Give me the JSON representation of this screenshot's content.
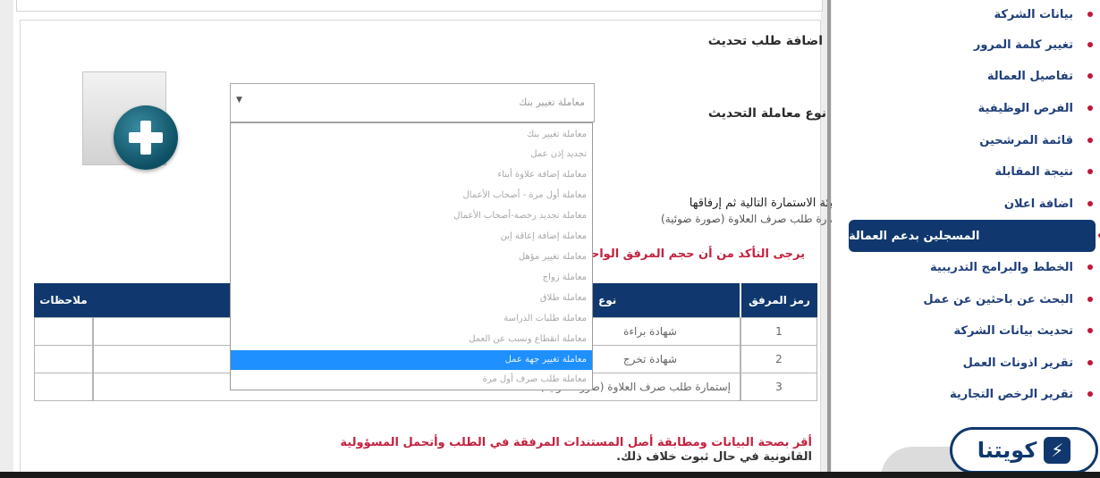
{
  "sidebar": {
    "items": [
      {
        "label": "بيانات الشركة"
      },
      {
        "label": "تغيير كلمة المرور"
      },
      {
        "label": "تفاصيل العمالة"
      },
      {
        "label": "الفرص الوظيفية"
      },
      {
        "label": "قائمة المرشحين"
      },
      {
        "label": "نتيجة المقابلة"
      },
      {
        "label": "اضافة اعلان"
      },
      {
        "label": "المسجلين بدعم العمالة",
        "active": true
      },
      {
        "label": "الخطط والبرامج التدريبية"
      },
      {
        "label": "البحث عن باحثين عن عمل"
      },
      {
        "label": "تحديث بيانات الشركة"
      },
      {
        "label": "تقرير اذونات العمل"
      },
      {
        "label": "تقرير الرخص التجارية"
      }
    ]
  },
  "form": {
    "title": "اضافة طلب تحديث",
    "type_label": "نوع معاملة التحديث",
    "select_value": "معاملة تغيير بنك",
    "options": [
      "معاملة تغيير بنك",
      "تجديد إذن عمل",
      "معاملة إضافة علاوة أبناء",
      "معاملة أول مرة - أصحاب الأعمال",
      "معاملة تجديد رخصة-أصحاب الأعمال",
      "معاملة إضافة إعاقة إبن",
      "معاملة تغيير مؤهل",
      "معاملة زواج",
      "معاملة طلاق",
      "معاملة طلبات الدراسة",
      "معاملة انقطاع ونسب عن العمل",
      "معاملة تغيير جهة عمل",
      "معاملة طلب صرف أول مرة"
    ],
    "selected_option_index": 11,
    "note_line1": "يرجى تعبئة الاستمارة التالية ثم إرفاقها",
    "note_line2": "إستمارة طلب صرف العلاوة (صورة ضوئية)",
    "size_warning": "يرجى التأكد من أن حجم المرفق الواحد",
    "confirm_line1": "أقر بصحة البيانات ومطابقة أصل المستندات المرفقة في الطلب وأتحمل المسؤولية",
    "confirm_line2": "القانونية في حال ثبوت خلاف ذلك."
  },
  "table": {
    "headers": {
      "code": "رمز المرفق",
      "type": "نوع",
      "notes": "ملاحظات"
    },
    "rows": [
      {
        "code": "1",
        "type": "شهادة براءة"
      },
      {
        "code": "2",
        "type": "شهادة تخرج"
      },
      {
        "code": "3",
        "type": "إستمارة طلب صرف العلاوة (صورة ضوئية)"
      }
    ]
  },
  "brand": {
    "name": "كويتنا",
    "accent": "#10386e",
    "alert": "#c2223f"
  }
}
